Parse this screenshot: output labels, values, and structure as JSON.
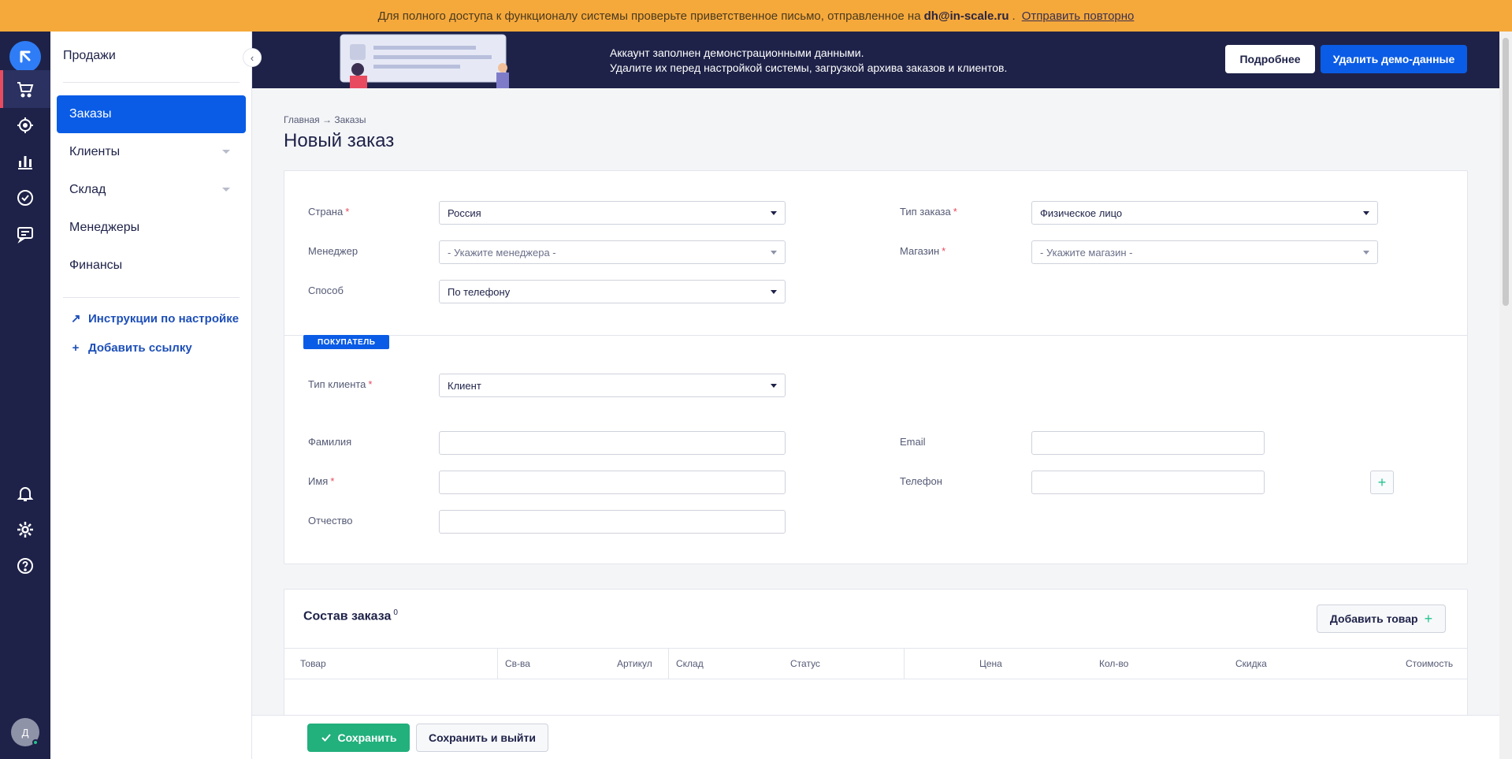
{
  "banner": {
    "text": "Для полного доступа к функционалу системы проверьте приветственное письмо, отправленное на",
    "email": "dh@in-scale.ru",
    "dot": ".",
    "resend": "Отправить повторно"
  },
  "rail": {
    "icons": [
      "logo-icon",
      "cart-icon",
      "target-icon",
      "analytics-icon",
      "tasks-icon",
      "chat-icon",
      "bell-icon",
      "gear-icon",
      "help-icon"
    ],
    "avatar": "Д"
  },
  "sidebar": {
    "section": "Продажи",
    "items": [
      {
        "label": "Заказы",
        "active": true
      },
      {
        "label": "Клиенты"
      },
      {
        "label": "Склад"
      },
      {
        "label": "Менеджеры"
      },
      {
        "label": "Финансы"
      }
    ],
    "links": [
      {
        "icon": "↗",
        "label": "Инструкции по настройке"
      },
      {
        "icon": "+",
        "label": "Добавить ссылку"
      }
    ]
  },
  "demo": {
    "line1": "Аккаунт заполнен демонстрационными данными.",
    "line2": "Удалите их перед настройкой системы, загрузкой архива заказов и клиентов.",
    "more": "Подробнее",
    "delete": "Удалить демо-данные"
  },
  "breadcrumb": "Главная → Заказы",
  "page_title": "Новый заказ",
  "form": {
    "country": {
      "label": "Страна",
      "value": "Россия"
    },
    "manager": {
      "label": "Менеджер",
      "placeholder": "- Укажите менеджера -"
    },
    "method": {
      "label": "Способ",
      "value": "По телефону"
    },
    "order_type": {
      "label": "Тип заказа",
      "value": "Физическое лицо"
    },
    "shop": {
      "label": "Магазин",
      "placeholder": "- Укажите магазин -"
    },
    "buyer_badge": "ПОКУПАТЕЛЬ",
    "client_type": {
      "label": "Тип клиента",
      "value": "Клиент"
    },
    "lastname": {
      "label": "Фамилия",
      "value": ""
    },
    "firstname": {
      "label": "Имя",
      "value": ""
    },
    "middlename": {
      "label": "Отчество",
      "value": ""
    },
    "email": {
      "label": "Email",
      "value": ""
    },
    "phone": {
      "label": "Телефон",
      "value": ""
    },
    "required_mark": "*"
  },
  "composition": {
    "title": "Состав заказа",
    "count": "0",
    "add_button": "Добавить товар",
    "columns": [
      "Товар",
      "Св-ва",
      "Артикул",
      "Склад",
      "Статус",
      "Цена",
      "Кол-во",
      "Скидка",
      "Стоимость"
    ]
  },
  "footer": {
    "save": "Сохранить",
    "save_exit": "Сохранить и выйти"
  },
  "colors": {
    "banner": "#f6a93b",
    "rail": "#1e2248",
    "accent": "#0a5ce6",
    "save": "#22b07d",
    "required": "#e84a5f"
  }
}
